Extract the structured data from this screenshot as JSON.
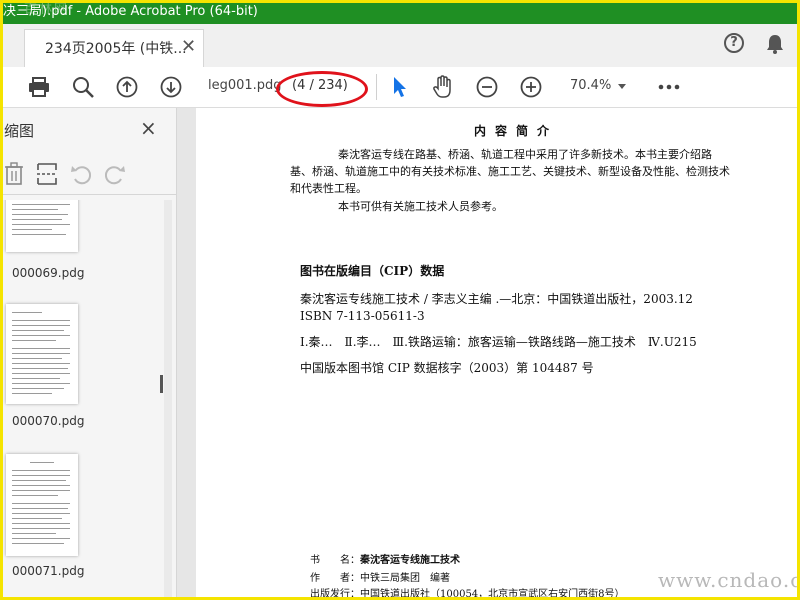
{
  "window": {
    "title": "决三局).pdf - Adobe Acrobat Pro (64-bit)",
    "watermark_logo": "百林网",
    "title_bar_color": "#1f8f23"
  },
  "tabs": [
    {
      "label": "234页2005年 (中铁...",
      "close_icon": "close-icon"
    }
  ],
  "header_icons": [
    "help-icon",
    "bell-icon"
  ],
  "toolbar": {
    "icons": [
      "print-icon",
      "search-zoom-icon",
      "page-up-icon",
      "page-down-icon",
      "select-arrow-icon",
      "hand-icon",
      "zoom-out-icon",
      "zoom-in-icon",
      "more-icon"
    ],
    "filename": "leg001.pdg",
    "page_indicator": "(4 / 234)",
    "zoom": "70.4%"
  },
  "sidepane": {
    "title": "缩图",
    "close": "×",
    "tools": [
      "delete-icon",
      "insert-page-icon",
      "rotate-left-icon",
      "rotate-right-icon"
    ],
    "thumbnails": [
      {
        "label": "000069.pdg"
      },
      {
        "label": "000070.pdg"
      },
      {
        "label": "000071.pdg"
      }
    ]
  },
  "document": {
    "intro_heading": "内容简介",
    "intro_paragraph": "秦沈客运专线在路基、桥涵、轨道工程中采用了许多新技术。本书主要介绍路基、桥涵、轨道施工中的有关技术标准、施工工艺、关键技术、新型设备及性能、检测技术和代表性工程。",
    "intro_note": "本书可供有关施工技术人员参考。",
    "cip_heading": "图书在版编目（CIP）数据",
    "cip_lines": [
      "秦沈客运专线施工技术 / 李志义主编 .—北京：中国铁道出版社，2003.12",
      "ISBN 7-113-05611-3",
      "Ⅰ.秦…　Ⅱ.李…　Ⅲ.铁路运输：旅客运输—铁路线路—施工技术　Ⅳ.U215",
      "中国版本图书馆 CIP 数据核字（2003）第 104487 号"
    ],
    "colophon": [
      {
        "key": "书　　名：",
        "value": "秦沈客运专线施工技术"
      },
      {
        "key": "作　　者：",
        "value": "中铁三局集团　编著"
      },
      {
        "key": "出版发行：",
        "value": "中国铁道出版社（100054，北京市宣武区右安门西街8号）"
      }
    ]
  },
  "site_watermark": "www.cndao.com"
}
